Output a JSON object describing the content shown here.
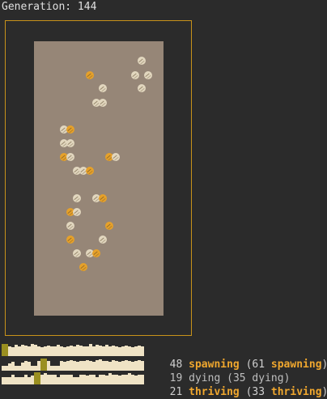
{
  "header": {
    "generation_label": "Generation: 144"
  },
  "colors": {
    "frame": "#c8921a",
    "board": "#968677",
    "alive_cell": "#e2d7bf",
    "born_cell": "#e6a12a",
    "histogram": "#efe3c5",
    "histogram_marker": "#9a8f20",
    "highlight_text": "#f0a72e"
  },
  "stats": [
    {
      "count": "48",
      "label": "spawning",
      "paren_count": "61",
      "paren_label": "spawning",
      "emphasis": true
    },
    {
      "count": "19",
      "label": "dying",
      "paren_count": "35",
      "paren_label": "dying",
      "emphasis": false
    },
    {
      "count": "21",
      "label": "thriving",
      "paren_count": "33",
      "paren_label": "thriving",
      "emphasis": true
    }
  ]
}
